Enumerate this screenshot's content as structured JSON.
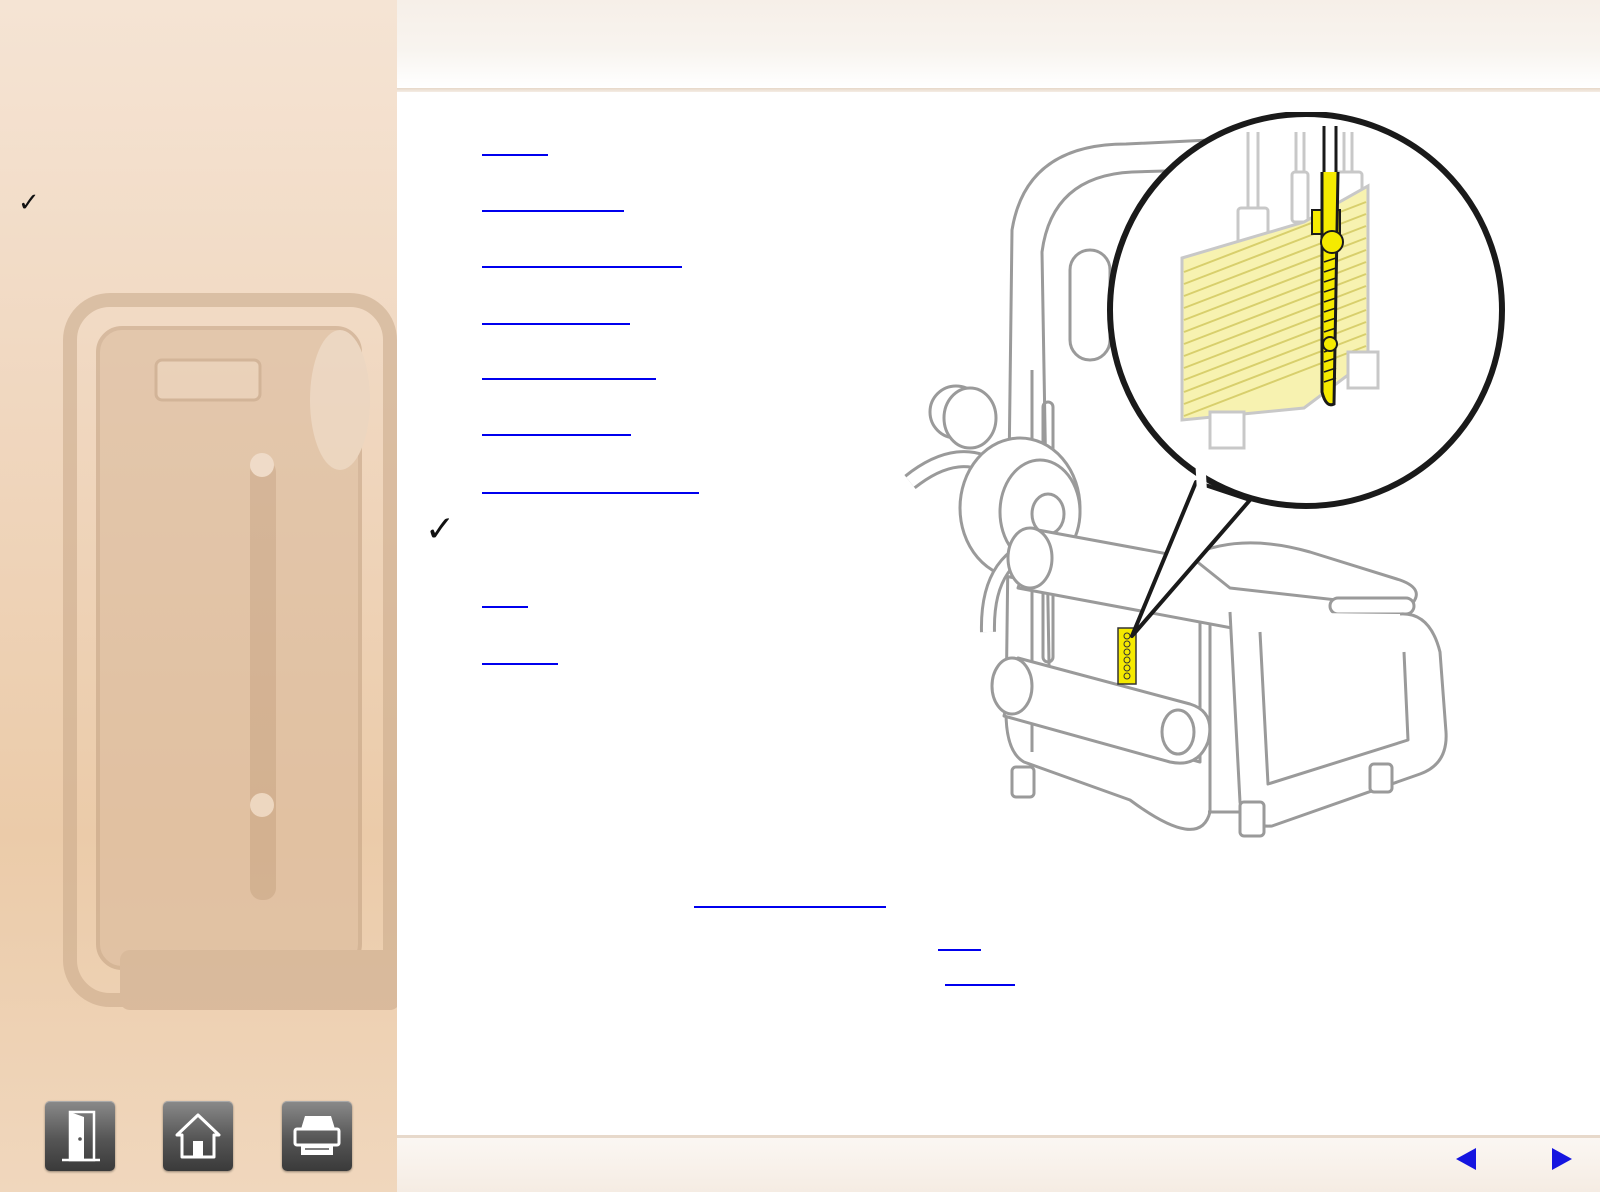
{
  "sidebar": {
    "checkmark": "✓",
    "buttons": [
      {
        "name": "exit",
        "icon": "exit-door-icon"
      },
      {
        "name": "home",
        "icon": "home-icon"
      },
      {
        "name": "print",
        "icon": "printer-icon"
      }
    ]
  },
  "main": {
    "checkmark": "✓",
    "links": [
      {
        "label": ""
      },
      {
        "label": ""
      },
      {
        "label": ""
      },
      {
        "label": ""
      },
      {
        "label": ""
      },
      {
        "label": ""
      },
      {
        "label": ""
      },
      {
        "label": ""
      },
      {
        "label": ""
      }
    ],
    "inline_links": [
      {
        "label": ""
      },
      {
        "label": ""
      },
      {
        "label": ""
      }
    ],
    "illustration": "leg-extension-machine-with-weight-stack-detail",
    "highlight_color": "#f5ea00"
  },
  "footer": {
    "prev_icon": "left-arrow-icon",
    "next_icon": "right-arrow-icon",
    "arrow_color": "#1515e0"
  }
}
